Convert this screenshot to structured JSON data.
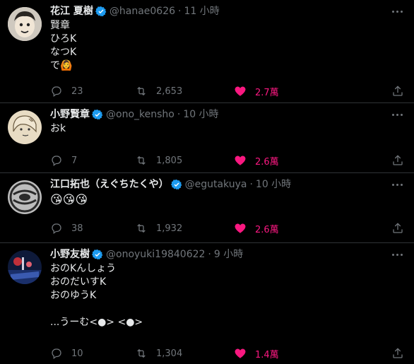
{
  "colors": {
    "background": "#000000",
    "text": "#e7e9ea",
    "muted": "#71767b",
    "like": "#f91880",
    "verified": "#1d9bf0",
    "divider": "#2f3336"
  },
  "tweets": [
    {
      "name": "花江 夏樹",
      "handle": "@hanae0626",
      "time": "11 小時",
      "lines": [
        "賢章",
        "ひろK",
        "なつK",
        "で🙆"
      ],
      "replies": "23",
      "retweets": "2,653",
      "likes": "2.7萬"
    },
    {
      "name": "小野賢章",
      "handle": "@ono_kensho",
      "time": "10 小時",
      "lines": [
        "おk"
      ],
      "replies": "7",
      "retweets": "1,805",
      "likes": "2.6萬"
    },
    {
      "name": "江口拓也（えぐちたくや）",
      "handle": "@egutakuya",
      "time": "10 小時",
      "lines": [
        "😘😘😘"
      ],
      "replies": "38",
      "retweets": "1,932",
      "likes": "2.6萬"
    },
    {
      "name": "小野友樹",
      "handle": "@onoyuki19840622",
      "time": "9 小時",
      "lines": [
        "おのKんしょう",
        "おのだいすK",
        "おのゆうK",
        "",
        "...うーむ<●> <●>"
      ],
      "replies": "10",
      "retweets": "1,304",
      "likes": "1.4萬"
    }
  ],
  "icons": [
    "reply-icon",
    "retweet-icon",
    "like-icon",
    "share-icon",
    "verified-badge-icon",
    "more-icon"
  ]
}
